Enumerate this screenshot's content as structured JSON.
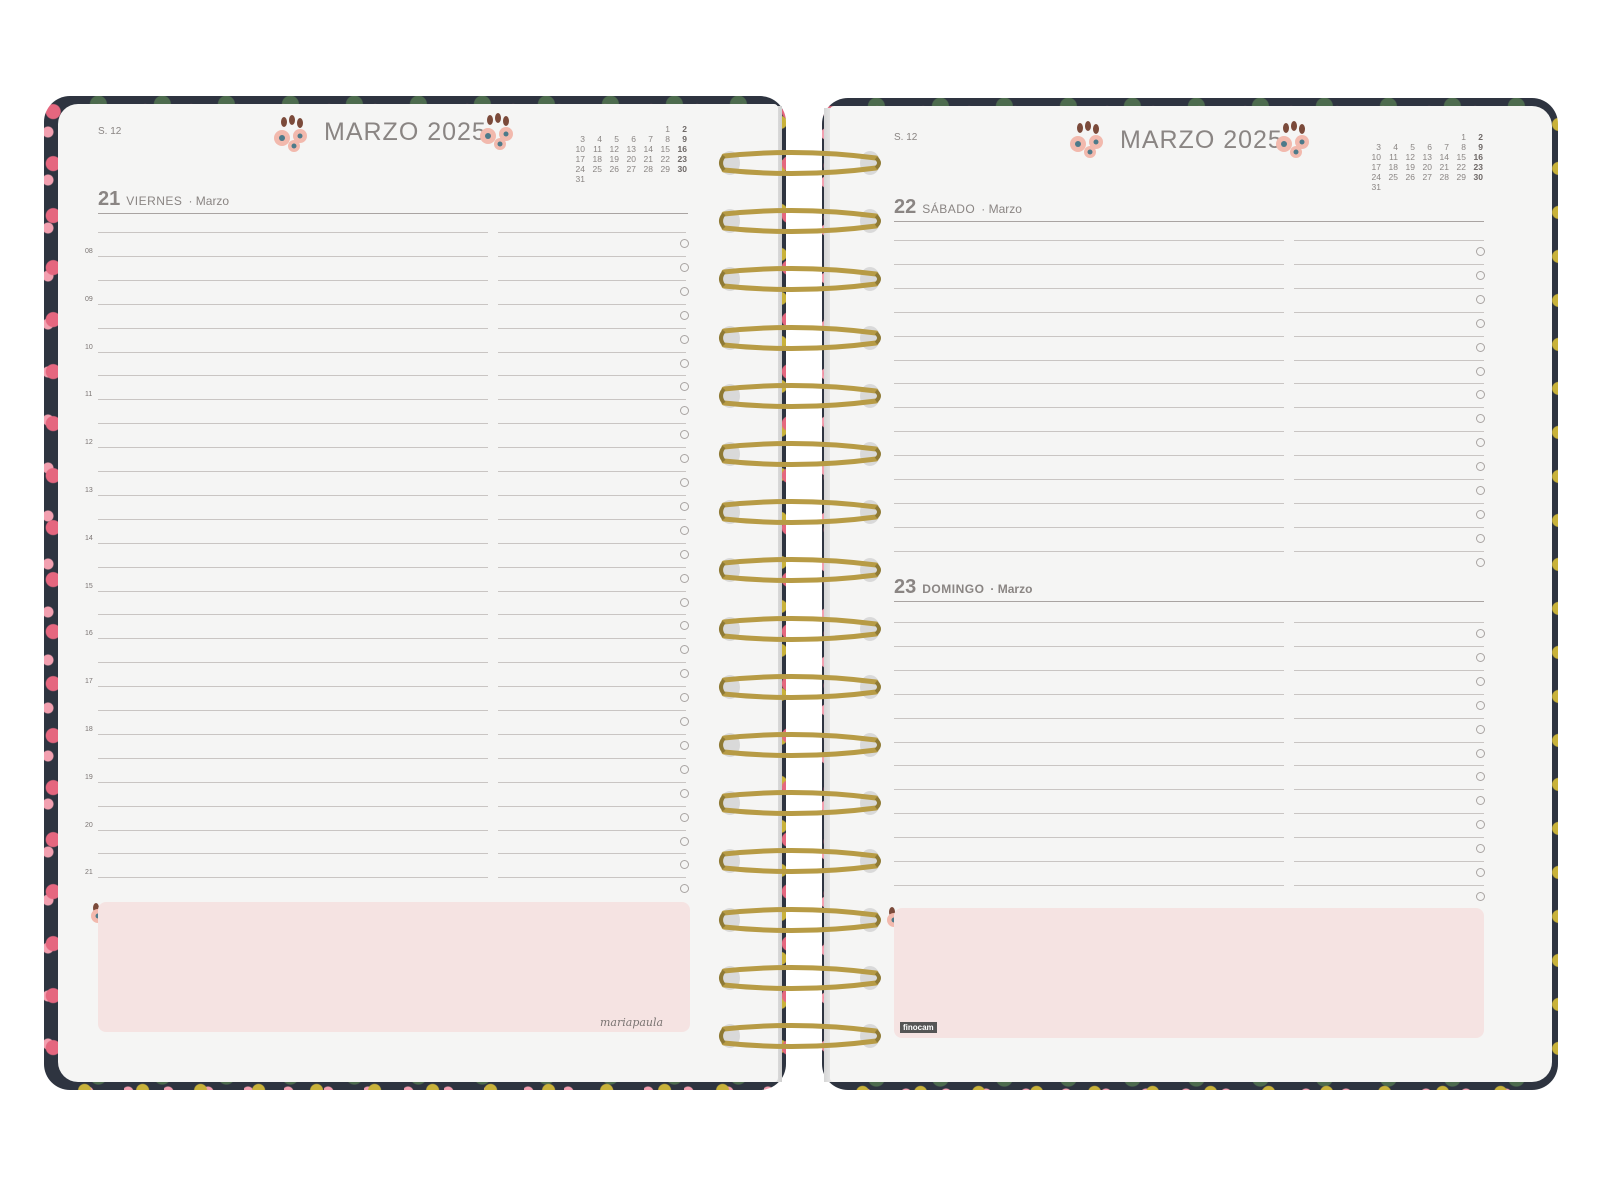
{
  "colors": {
    "page": "#f5f5f4",
    "text": "#8a8583",
    "notes": "#f5e3e2",
    "ring": "#b79b45",
    "cover": "#2e3440"
  },
  "left_page": {
    "week": "S. 12",
    "month_title": "MARZO 2025",
    "day_number": "21",
    "day_name": "VIERNES",
    "day_month": "· Marzo",
    "hours": [
      "08",
      "09",
      "10",
      "11",
      "12",
      "13",
      "14",
      "15",
      "16",
      "17",
      "18",
      "19",
      "20",
      "21"
    ],
    "signature": "mariapaula"
  },
  "right_page": {
    "week": "S. 12",
    "month_title": "MARZO 2025",
    "day1_number": "22",
    "day1_name": "SÁBADO",
    "day1_month": "· Marzo",
    "day2_number": "23",
    "day2_name": "DOMINGO",
    "day2_month": "· Marzo",
    "brand": "finocam"
  },
  "mini_calendar": [
    [
      "",
      "",
      "",
      "",
      "",
      "1",
      "2"
    ],
    [
      "3",
      "4",
      "5",
      "6",
      "7",
      "8",
      "9"
    ],
    [
      "10",
      "11",
      "12",
      "13",
      "14",
      "15",
      "16"
    ],
    [
      "17",
      "18",
      "19",
      "20",
      "21",
      "22",
      "23"
    ],
    [
      "24",
      "25",
      "26",
      "27",
      "28",
      "29",
      "30"
    ],
    [
      "31",
      "",
      "",
      "",
      "",
      "",
      ""
    ]
  ],
  "icons": {
    "flower": "flower-cluster-icon",
    "ring": "spiral-ring-icon"
  }
}
